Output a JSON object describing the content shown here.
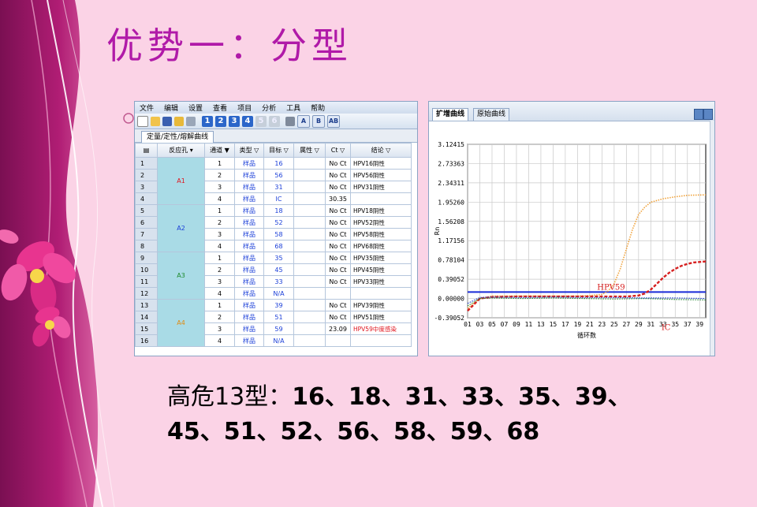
{
  "slide": {
    "title": "优势一：分型"
  },
  "table_window": {
    "menu": [
      "文件",
      "编辑",
      "设置",
      "查看",
      "项目",
      "分析",
      "工具",
      "帮助"
    ],
    "toolbar_numbers": [
      "1",
      "2",
      "3",
      "4",
      "5",
      "6"
    ],
    "toolbar_letters": [
      "A",
      "B",
      "AB"
    ],
    "tab": "定量/定性/熔解曲线",
    "columns": [
      "反应孔",
      "通道",
      "类型",
      "目标",
      "属性",
      "Ct",
      "结论"
    ],
    "wells": [
      {
        "label": "A1",
        "rows": [
          [
            "1",
            "1",
            "样品",
            "16",
            "",
            "No Ct",
            "HPV16阴性"
          ],
          [
            "2",
            "2",
            "样品",
            "56",
            "",
            "No Ct",
            "HPV56阴性"
          ],
          [
            "3",
            "3",
            "样品",
            "31",
            "",
            "No Ct",
            "HPV31阴性"
          ],
          [
            "4",
            "4",
            "样品",
            "IC",
            "",
            "30.35",
            ""
          ]
        ]
      },
      {
        "label": "A2",
        "rows": [
          [
            "5",
            "1",
            "样品",
            "18",
            "",
            "No Ct",
            "HPV18阴性"
          ],
          [
            "6",
            "2",
            "样品",
            "52",
            "",
            "No Ct",
            "HPV52阴性"
          ],
          [
            "7",
            "3",
            "样品",
            "58",
            "",
            "No Ct",
            "HPV58阴性"
          ],
          [
            "8",
            "4",
            "样品",
            "68",
            "",
            "No Ct",
            "HPV68阴性"
          ]
        ]
      },
      {
        "label": "A3",
        "rows": [
          [
            "9",
            "1",
            "样品",
            "35",
            "",
            "No Ct",
            "HPV35阴性"
          ],
          [
            "10",
            "2",
            "样品",
            "45",
            "",
            "No Ct",
            "HPV45阴性"
          ],
          [
            "11",
            "3",
            "样品",
            "33",
            "",
            "No Ct",
            "HPV33阴性"
          ],
          [
            "12",
            "4",
            "样品",
            "N/A",
            "",
            "",
            ""
          ]
        ]
      },
      {
        "label": "A4",
        "rows": [
          [
            "13",
            "1",
            "样品",
            "39",
            "",
            "No Ct",
            "HPV39阴性"
          ],
          [
            "14",
            "2",
            "样品",
            "51",
            "",
            "No Ct",
            "HPV51阴性"
          ],
          [
            "15",
            "3",
            "样品",
            "59",
            "",
            "23.09",
            "HPV59中度感染"
          ],
          [
            "16",
            "4",
            "样品",
            "N/A",
            "",
            "",
            ""
          ]
        ]
      }
    ],
    "well_colors": [
      "#e0141d",
      "#1b3fd8",
      "#1d8a2c",
      "#e08a10"
    ]
  },
  "chart_window": {
    "tabs": [
      "扩增曲线",
      "原始曲线"
    ],
    "ylabel": "Rn",
    "xlabel": "循环数",
    "yticks": [
      "3.12415",
      "2.73363",
      "2.34311",
      "1.95260",
      "1.56208",
      "1.17156",
      "0.78104",
      "0.39052",
      "0.00000",
      "-0.39052"
    ],
    "xticks": [
      "01",
      "03",
      "05",
      "07",
      "09",
      "11",
      "13",
      "15",
      "17",
      "19",
      "21",
      "23",
      "25",
      "27",
      "29",
      "31",
      "33",
      "35",
      "37",
      "39"
    ],
    "annotations": [
      "HPV59",
      "IC"
    ]
  },
  "chart_data": {
    "type": "line",
    "xlabel": "循环数",
    "ylabel": "Rn",
    "xlim": [
      1,
      40
    ],
    "ylim": [
      -0.39052,
      3.12415
    ],
    "threshold": 0.13,
    "series": [
      {
        "name": "HPV59",
        "color": "#f0a23a",
        "x": [
          1,
          3,
          5,
          7,
          9,
          11,
          13,
          15,
          17,
          19,
          21,
          23,
          24,
          25,
          26,
          27,
          28,
          29,
          30,
          31,
          33,
          35,
          37,
          40
        ],
        "y": [
          -0.2,
          0.0,
          0.05,
          0.05,
          0.05,
          0.05,
          0.05,
          0.05,
          0.05,
          0.05,
          0.06,
          0.08,
          0.15,
          0.3,
          0.6,
          1.0,
          1.4,
          1.7,
          1.85,
          1.95,
          2.02,
          2.06,
          2.09,
          2.1
        ]
      },
      {
        "name": "IC",
        "color": "#d61f1f",
        "x": [
          1,
          3,
          5,
          9,
          13,
          17,
          21,
          25,
          27,
          29,
          30,
          31,
          32,
          33,
          34,
          35,
          36,
          37,
          38,
          40
        ],
        "y": [
          -0.25,
          0.0,
          0.03,
          0.04,
          0.04,
          0.04,
          0.04,
          0.04,
          0.04,
          0.06,
          0.1,
          0.18,
          0.3,
          0.42,
          0.52,
          0.6,
          0.66,
          0.7,
          0.73,
          0.75
        ]
      },
      {
        "color": "#2a8a36",
        "x": [
          1,
          3,
          5,
          10,
          15,
          20,
          25,
          30,
          35,
          40
        ],
        "y": [
          -0.15,
          0.0,
          0.01,
          0.0,
          0.01,
          0.0,
          -0.01,
          0.0,
          -0.02,
          -0.03
        ]
      },
      {
        "color": "#1c3fc8",
        "x": [
          1,
          3,
          5,
          10,
          15,
          20,
          25,
          30,
          35,
          40
        ],
        "y": [
          -0.1,
          0.02,
          0.03,
          0.02,
          0.03,
          0.02,
          0.02,
          0.01,
          0.01,
          0.0
        ]
      }
    ]
  },
  "bottom_text": {
    "line1_lead": "高危13型：",
    "line1_rest": "16、18、31、33、35、39、",
    "line2": "45、51、52、56、58、59、68"
  }
}
